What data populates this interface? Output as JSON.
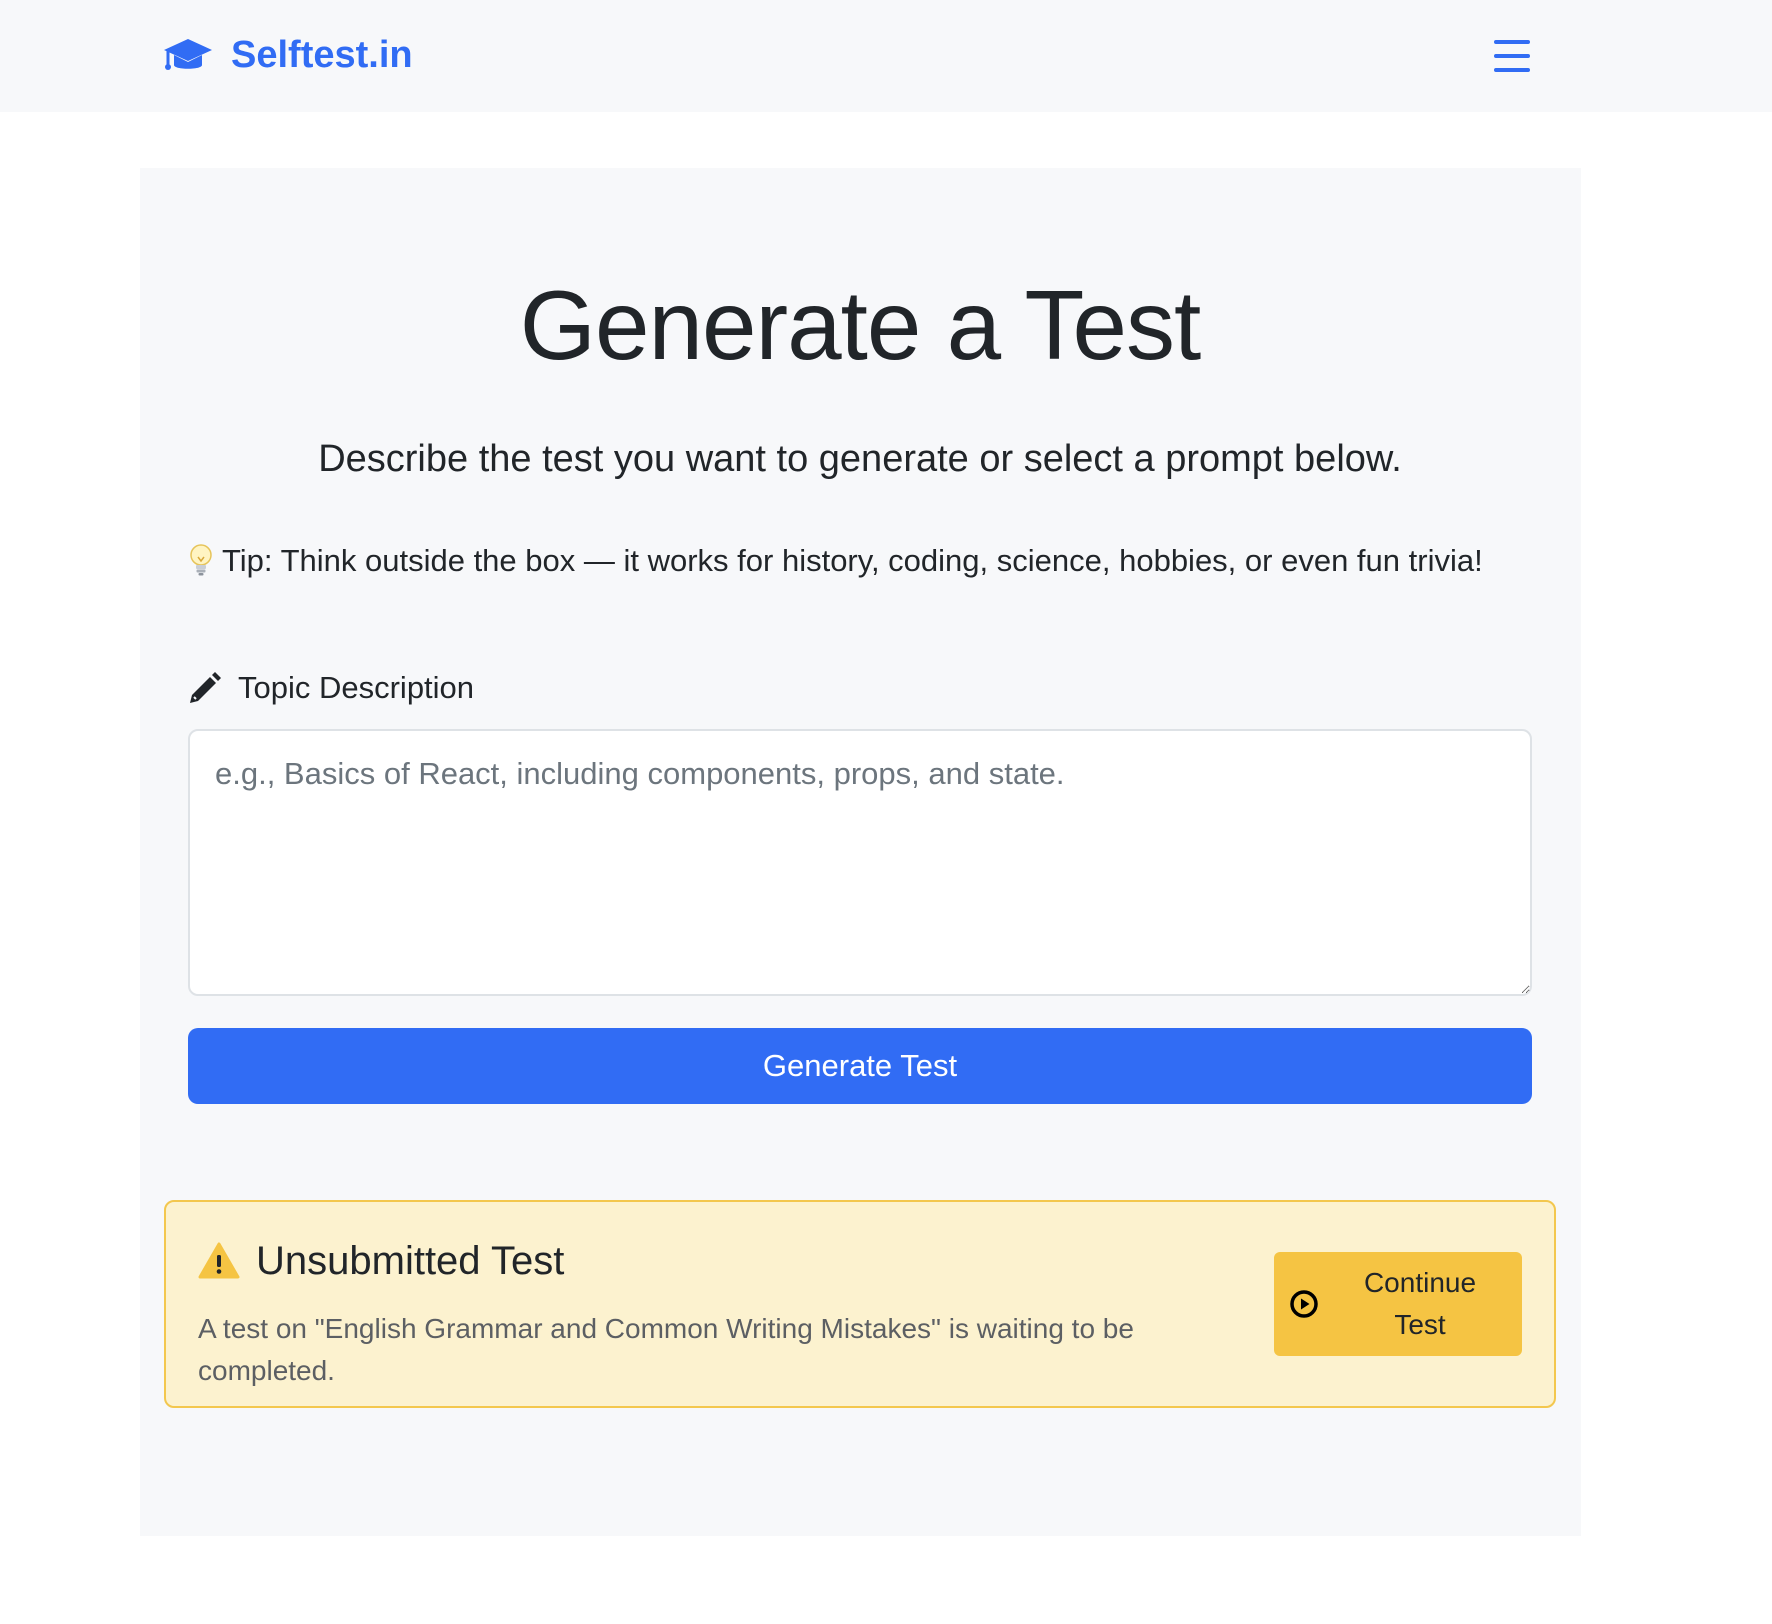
{
  "navbar": {
    "brand": "Selftest.in",
    "brand_icon": "graduation-cap-icon",
    "menu_icon": "hamburger-menu-icon",
    "accent_color": "#316cf4"
  },
  "main": {
    "title": "Generate a Test",
    "lead": "Describe the test you want to generate or select a prompt below.",
    "tip": "Tip: Think outside the box — it works for history, coding, science, hobbies, or even fun trivia!",
    "tip_icon": "lightbulb-icon",
    "field_label": "Topic Description",
    "field_icon": "pencil-icon",
    "topic_placeholder": "e.g., Basics of React, including components, props, and state.",
    "topic_value": "",
    "generate_label": "Generate Test"
  },
  "alert": {
    "icon": "warning-icon",
    "heading": "Unsubmitted Test",
    "text": "A test on \"English Grammar and Common Writing Mistakes\" is waiting to be completed.",
    "button_label": "Continue\nTest",
    "button_icon": "play-circle-icon",
    "background_color": "#fcf2cf",
    "border_color": "#f3c74e",
    "button_color": "#f5c443"
  }
}
